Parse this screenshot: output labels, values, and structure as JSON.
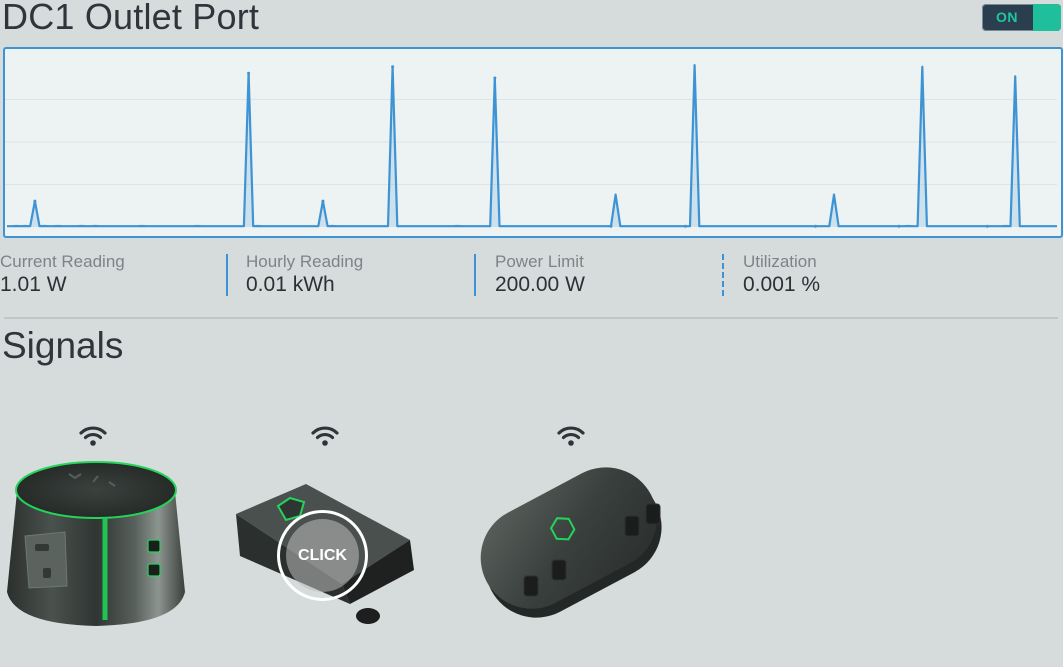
{
  "header": {
    "title": "DC1 Outlet Port",
    "toggle_label": "ON",
    "toggle_state": "on",
    "accent_color": "#1fbf9b"
  },
  "chart_data": {
    "type": "area",
    "series": [
      {
        "values": [
          0.5,
          0.5,
          0.6,
          0.5,
          0.6,
          0.5,
          16,
          0.5,
          0.6,
          0.5,
          0.5,
          0.6,
          0.5,
          0.5,
          0.5,
          0.5,
          0.6,
          0.5,
          0.5,
          0.6,
          0.5,
          0.5,
          0.5,
          0.5,
          0.5,
          0.5,
          0.5,
          0.5,
          0.5,
          0.6,
          0.5,
          0.5,
          0.5,
          0.5,
          0.5,
          0.5,
          0.5,
          0.5,
          0.5,
          0.5,
          0.5,
          0.6,
          0.5,
          0.5,
          0.5,
          0.5,
          0.5,
          0.5,
          0.5,
          0.5,
          0.5,
          0.5,
          95,
          0.5,
          0.6,
          0.5,
          0.5,
          0.5,
          0.5,
          0.5,
          0.5,
          0.5,
          0.5,
          0.5,
          0.5,
          0.5,
          0.5,
          0.5,
          16,
          0.5,
          0.6,
          0.5,
          0.5,
          0.5,
          0.5,
          0.5,
          0.5,
          0.5,
          0.5,
          0.5,
          0.5,
          0.5,
          0.5,
          99,
          0.5,
          0.5,
          0.5,
          0.5,
          0.5,
          0.5,
          0.5,
          0.5,
          0.5,
          0.5,
          0.5,
          0.5,
          0.5,
          0.6,
          0.5,
          0.5,
          0.5,
          0.5,
          0.5,
          0.5,
          0.5,
          92,
          0.5,
          0.5,
          0.5,
          0.5,
          0.5,
          0.5,
          0.5,
          0.5,
          0.5,
          0.5,
          0.5,
          0.5,
          0.5,
          0.5,
          0.5,
          0.5,
          0.5,
          0.5,
          0.5,
          0.5,
          0.5,
          0.5,
          0.5,
          0.5,
          0.5,
          20,
          0.5,
          0.5,
          0.5,
          0.5,
          0.5,
          0.5,
          0.5,
          0.5,
          0.5,
          0.5,
          0.5,
          0.5,
          0.5,
          0.5,
          0.5,
          0.5,
          100,
          0.5,
          0.5,
          0.5,
          0.5,
          0.5,
          0.5,
          0.5,
          0.5,
          0.5,
          0.5,
          0.5,
          0.5,
          0.5,
          0.5,
          0.5,
          0.5,
          0.5,
          0.5,
          0.5,
          0.5,
          0.5,
          0.5,
          0.5,
          0.5,
          0.5,
          0.5,
          0.5,
          0.5,
          0.5,
          20,
          0.5,
          0.5,
          0.5,
          0.5,
          0.5,
          0.5,
          0.5,
          0.5,
          0.5,
          0.5,
          0.5,
          0.5,
          0.5,
          0.5,
          0.5,
          0.6,
          0.5,
          0.5,
          99,
          0.5,
          0.5,
          0.5,
          0.5,
          0.5,
          0.5,
          0.5,
          0.5,
          0.5,
          0.5,
          0.5,
          0.5,
          0.5,
          0.5,
          0.5,
          0.5,
          0.5,
          0.6,
          0.5,
          93,
          0.5,
          0.5,
          0.5,
          0.5,
          0.5,
          0.5,
          0.5,
          0.5,
          0.5
        ]
      }
    ],
    "peak_indices": [
      6,
      52,
      68,
      83,
      105,
      130,
      146,
      174,
      192,
      211
    ],
    "ylim": [
      0,
      105
    ],
    "grid": true,
    "line_color": "#3d93d3"
  },
  "metrics": [
    {
      "label": "Current Reading",
      "value": "1.01 W"
    },
    {
      "label": "Hourly Reading",
      "value": "0.01 kWh"
    },
    {
      "label": "Power Limit",
      "value": "200.00 W"
    },
    {
      "label": "Utilization",
      "value": "0.001 %"
    }
  ],
  "signals": {
    "title": "Signals",
    "click_label": "CLICK",
    "devices": [
      {
        "name": "round-outlet-hub",
        "icon": "wifi-icon"
      },
      {
        "name": "box-outlet-adapter",
        "icon": "wifi-icon"
      },
      {
        "name": "oval-outlet-strip",
        "icon": "wifi-icon"
      }
    ]
  }
}
